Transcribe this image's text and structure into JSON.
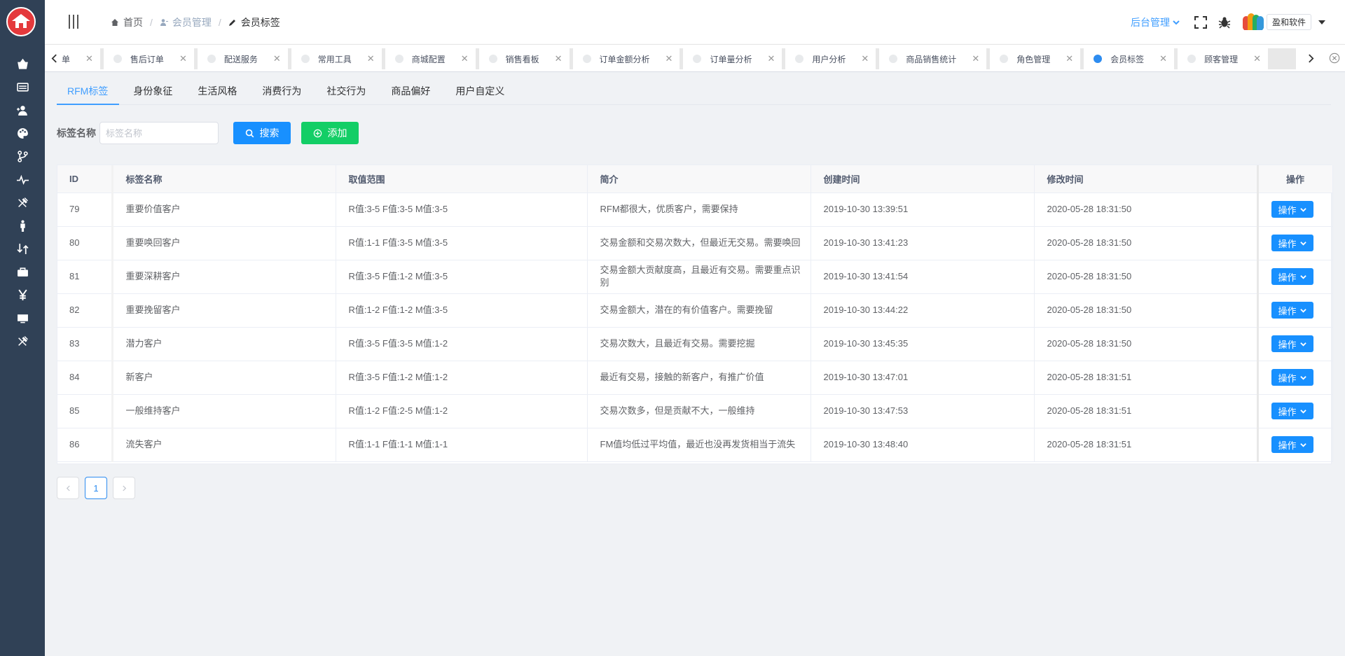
{
  "sidebar": {
    "icons": [
      "basket-icon",
      "list-icon",
      "user-add-icon",
      "palette-icon",
      "branch-icon",
      "pulse-icon",
      "tools-icon",
      "person-icon",
      "exchange-icon",
      "briefcase-icon",
      "yen-icon",
      "monitor-icon",
      "tools-icon"
    ]
  },
  "header": {
    "breadcrumb": [
      "首页",
      "会员管理",
      "会员标签"
    ],
    "admin_menu": "后台管理",
    "company": "盈和软件"
  },
  "tabs": [
    {
      "label": "订单",
      "active": false
    },
    {
      "label": "售后订单",
      "active": false
    },
    {
      "label": "配送服务",
      "active": false
    },
    {
      "label": "常用工具",
      "active": false
    },
    {
      "label": "商城配置",
      "active": false
    },
    {
      "label": "销售看板",
      "active": false
    },
    {
      "label": "订单金额分析",
      "active": false
    },
    {
      "label": "订单量分析",
      "active": false
    },
    {
      "label": "用户分析",
      "active": false
    },
    {
      "label": "商品销售统计",
      "active": false
    },
    {
      "label": "角色管理",
      "active": false
    },
    {
      "label": "会员标签",
      "active": true
    },
    {
      "label": "顾客管理",
      "active": false
    }
  ],
  "subtabs": [
    {
      "label": "RFM标签",
      "active": true
    },
    {
      "label": "身份象征",
      "active": false
    },
    {
      "label": "生活风格",
      "active": false
    },
    {
      "label": "消费行为",
      "active": false
    },
    {
      "label": "社交行为",
      "active": false
    },
    {
      "label": "商品偏好",
      "active": false
    },
    {
      "label": "用户自定义",
      "active": false
    }
  ],
  "filter": {
    "label": "标签名称",
    "placeholder": "标签名称",
    "search_label": "搜索",
    "add_label": "添加"
  },
  "table": {
    "headers": [
      "ID",
      "标签名称",
      "取值范围",
      "简介",
      "创建时间",
      "修改时间",
      "操作"
    ],
    "op_label": "操作",
    "rows": [
      [
        "79",
        "重要价值客户",
        "R值:3-5 F值:3-5 M值:3-5",
        "RFM都很大，优质客户，需要保持",
        "2019-10-30 13:39:51",
        "2020-05-28 18:31:50"
      ],
      [
        "80",
        "重要唤回客户",
        "R值:1-1 F值:3-5 M值:3-5",
        "交易金额和交易次数大，但最近无交易。需要唤回",
        "2019-10-30 13:41:23",
        "2020-05-28 18:31:50"
      ],
      [
        "81",
        "重要深耕客户",
        "R值:3-5 F值:1-2 M值:3-5",
        "交易金额大贡献度高，且最近有交易。需要重点识别",
        "2019-10-30 13:41:54",
        "2020-05-28 18:31:50"
      ],
      [
        "82",
        "重要挽留客户",
        "R值:1-2 F值:1-2 M值:3-5",
        "交易金额大，潜在的有价值客户。需要挽留",
        "2019-10-30 13:44:22",
        "2020-05-28 18:31:50"
      ],
      [
        "83",
        "潜力客户",
        "R值:3-5 F值:3-5 M值:1-2",
        "交易次数大，且最近有交易。需要挖掘",
        "2019-10-30 13:45:35",
        "2020-05-28 18:31:50"
      ],
      [
        "84",
        "新客户",
        "R值:3-5 F值:1-2 M值:1-2",
        "最近有交易，接触的新客户，有推广价值",
        "2019-10-30 13:47:01",
        "2020-05-28 18:31:51"
      ],
      [
        "85",
        "一般维持客户",
        "R值:1-2 F值:2-5 M值:1-2",
        "交易次数多，但是贡献不大，一般维持",
        "2019-10-30 13:47:53",
        "2020-05-28 18:31:51"
      ],
      [
        "86",
        "流失客户",
        "R值:1-1 F值:1-1 M值:1-1",
        "FM值均低过平均值，最近也没再发货相当于流失",
        "2019-10-30 13:48:40",
        "2020-05-28 18:31:51"
      ]
    ]
  },
  "pager": {
    "current": "1"
  }
}
